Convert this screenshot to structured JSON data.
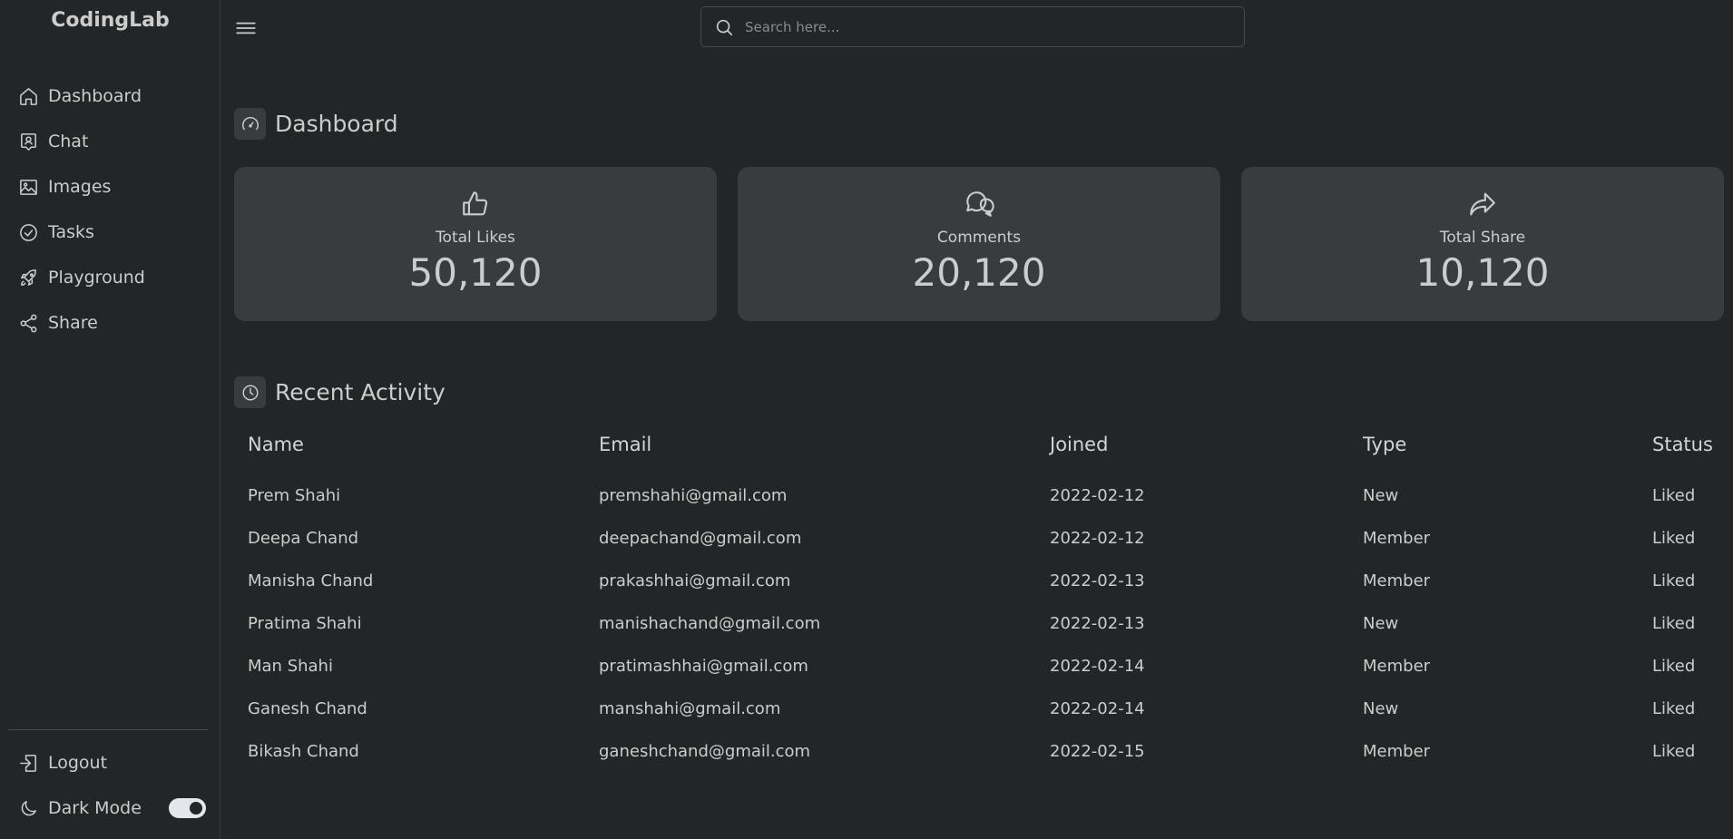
{
  "app": {
    "logo": "CodingLab"
  },
  "sidebar": {
    "items": [
      {
        "label": "Dashboard",
        "icon": "home-icon"
      },
      {
        "label": "Chat",
        "icon": "chat-icon"
      },
      {
        "label": "Images",
        "icon": "image-icon"
      },
      {
        "label": "Tasks",
        "icon": "check-circle-icon"
      },
      {
        "label": "Playground",
        "icon": "rocket-icon"
      },
      {
        "label": "Share",
        "icon": "share-icon"
      }
    ],
    "logout_label": "Logout",
    "dark_mode_label": "Dark Mode",
    "dark_mode_on": true
  },
  "search": {
    "placeholder": "Search here..."
  },
  "dashboard": {
    "title": "Dashboard",
    "cards": [
      {
        "label": "Total Likes",
        "value": "50,120",
        "icon": "thumbs-up-icon"
      },
      {
        "label": "Comments",
        "value": "20,120",
        "icon": "comments-icon"
      },
      {
        "label": "Total Share",
        "value": "10,120",
        "icon": "share-arrow-icon"
      }
    ]
  },
  "activity": {
    "title": "Recent Activity",
    "columns": [
      "Name",
      "Email",
      "Joined",
      "Type",
      "Status"
    ],
    "rows": [
      [
        "Prem Shahi",
        "premshahi@gmail.com",
        "2022-02-12",
        "New",
        "Liked"
      ],
      [
        "Deepa Chand",
        "deepachand@gmail.com",
        "2022-02-12",
        "Member",
        "Liked"
      ],
      [
        "Manisha Chand",
        "prakashhai@gmail.com",
        "2022-02-13",
        "Member",
        "Liked"
      ],
      [
        "Pratima Shahi",
        "manishachand@gmail.com",
        "2022-02-13",
        "New",
        "Liked"
      ],
      [
        "Man Shahi",
        "pratimashhai@gmail.com",
        "2022-02-14",
        "Member",
        "Liked"
      ],
      [
        "Ganesh Chand",
        "manshahi@gmail.com",
        "2022-02-14",
        "New",
        "Liked"
      ],
      [
        "Bikash Chand",
        "ganeshchand@gmail.com",
        "2022-02-15",
        "Member",
        "Liked"
      ]
    ]
  }
}
